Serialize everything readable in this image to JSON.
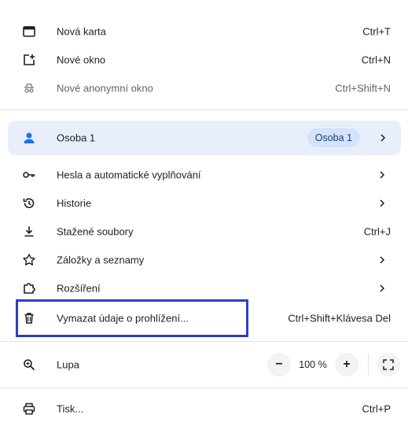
{
  "menu": {
    "new_tab": {
      "label": "Nová karta",
      "shortcut": "Ctrl+T",
      "icon": "new-tab-icon"
    },
    "new_window": {
      "label": "Nové okno",
      "shortcut": "Ctrl+N",
      "icon": "new-window-icon"
    },
    "incognito": {
      "label": "Nové anonymní okno",
      "shortcut": "Ctrl+Shift+N",
      "icon": "incognito-icon"
    },
    "profile": {
      "label": "Osoba 1",
      "badge": "Osoba 1",
      "icon": "person-icon"
    },
    "passwords": {
      "label": "Hesla a automatické vyplňování",
      "icon": "key-icon"
    },
    "history": {
      "label": "Historie",
      "icon": "history-icon"
    },
    "downloads": {
      "label": "Stažené soubory",
      "shortcut": "Ctrl+J",
      "icon": "download-icon"
    },
    "bookmarks": {
      "label": "Záložky a seznamy",
      "icon": "star-icon"
    },
    "extensions": {
      "label": "Rozšíření",
      "icon": "puzzle-icon"
    },
    "clear_data": {
      "label": "Vymazat údaje o prohlížení...",
      "shortcut": "Ctrl+Shift+Klávesa Del",
      "icon": "trash-icon"
    },
    "zoom": {
      "label": "Lupa",
      "minus": "−",
      "value": "100 %",
      "plus": "+",
      "icon": "zoom-icon"
    },
    "print": {
      "label": "Tisk...",
      "shortcut": "Ctrl+P",
      "icon": "printer-icon"
    }
  },
  "colors": {
    "highlight_border": "#2b3fc4",
    "profile_bg": "#e8effa",
    "badge_bg": "#d3e3fd",
    "person_icon": "#1a73e8"
  }
}
